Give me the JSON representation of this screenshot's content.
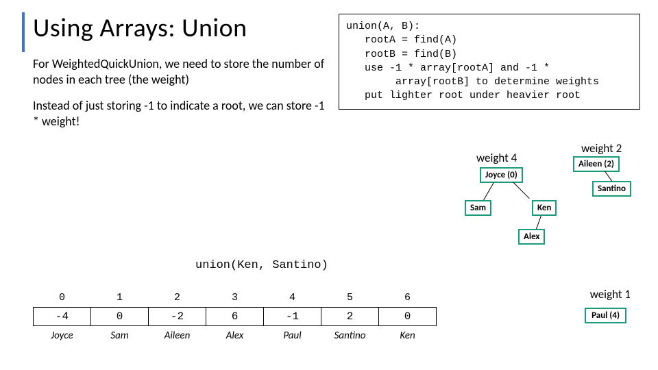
{
  "title": "Using Arrays: Union",
  "para1": "For WeightedQuickUnion, we need to store the number of nodes in each tree (the weight)",
  "para2": "Instead of just storing -1 to indicate a root, we can store -1 * weight!",
  "code": "union(A, B):\n   rootA = find(A)\n   rootB = find(B)\n   use -1 * array[rootA] and -1 *\n        array[rootB] to determine weights\n   put lighter root under heavier root",
  "union_call": "union(Ken, Santino)",
  "weights": {
    "w4": "weight 4",
    "w2": "weight 2",
    "w1": "weight 1"
  },
  "nodes": {
    "joyce": "Joyce (0)",
    "aileen": "Aileen (2)",
    "sam": "Sam",
    "ken": "Ken",
    "alex": "Alex",
    "santino": "Santino",
    "paul": "Paul (4)"
  },
  "table": {
    "idx": [
      "0",
      "1",
      "2",
      "3",
      "4",
      "5",
      "6"
    ],
    "vals": [
      "-4",
      "0",
      "-2",
      "6",
      "-1",
      "2",
      "0"
    ],
    "names": [
      "Joyce",
      "Sam",
      "Aileen",
      "Alex",
      "Paul",
      "Santino",
      "Ken"
    ]
  }
}
